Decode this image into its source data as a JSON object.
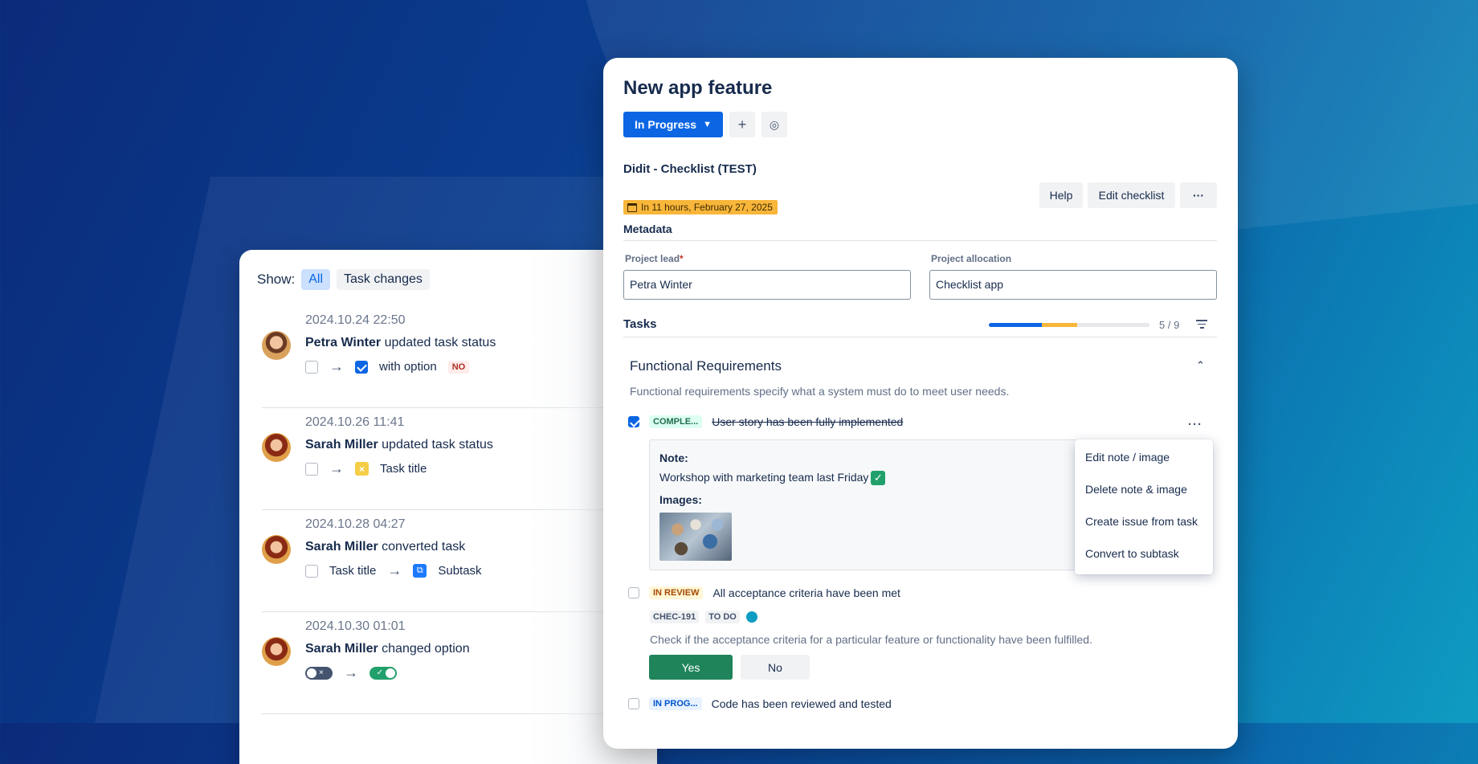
{
  "activity": {
    "show_label": "Show:",
    "filters": [
      "All",
      "Task changes"
    ],
    "entries": [
      {
        "time": "2024.10.24 22:50",
        "user": "Petra Winter",
        "action": "updated task status",
        "change_text": "with option",
        "badge": "NO"
      },
      {
        "time": "2024.10.26 11:41",
        "user": "Sarah Miller",
        "action": "updated task status",
        "change_text": "Task title"
      },
      {
        "time": "2024.10.28 04:27",
        "user": "Sarah Miller",
        "action": "converted task",
        "from_text": "Task title",
        "to_text": "Subtask"
      },
      {
        "time": "2024.10.30 01:01",
        "user": "Sarah Miller",
        "action": "changed option"
      }
    ]
  },
  "issue": {
    "title": "New app feature",
    "status_label": "In Progress",
    "checklist_title": "Didit - Checklist (TEST)",
    "help_label": "Help",
    "edit_label": "Edit checklist",
    "more_label": "···",
    "due_text": "In 11 hours, February 27, 2025",
    "metadata_title": "Metadata",
    "project_lead_label": "Project lead",
    "required_mark": "*",
    "project_lead_value": "Petra Winter",
    "project_allocation_label": "Project allocation",
    "project_allocation_value": "Checklist app",
    "tasks_title": "Tasks",
    "tasks_count": "5 / 9",
    "progress_done": 0.33,
    "progress_in_progress": 0.22,
    "section_title": "Functional Requirements",
    "section_desc": "Functional requirements specify what a system must do to meet user needs.",
    "tasks": [
      {
        "status": "COMPLE...",
        "text": "User story has been fully implemented",
        "checked": true
      },
      {
        "status": "IN REVIEW",
        "text": "All acceptance criteria have been met",
        "checked": false
      },
      {
        "status": "IN PROG...",
        "text": "Code has been reviewed and tested",
        "checked": false
      }
    ],
    "note_label": "Note:",
    "note_text": "Workshop with marketing team last Friday",
    "images_label": "Images:",
    "menu_items": [
      "Edit note / image",
      "Delete note & image",
      "Create issue from task",
      "Convert to subtask"
    ],
    "issue_key": "CHEC-191",
    "issue_status": "TO DO",
    "criteria_desc": "Check if the acceptance criteria for a particular feature or functionality have been fulfilled.",
    "yes_label": "Yes",
    "no_label": "No"
  },
  "colors": {
    "primary": "#0c66e4",
    "warning": "#f8b63a",
    "success": "#1f845a"
  }
}
